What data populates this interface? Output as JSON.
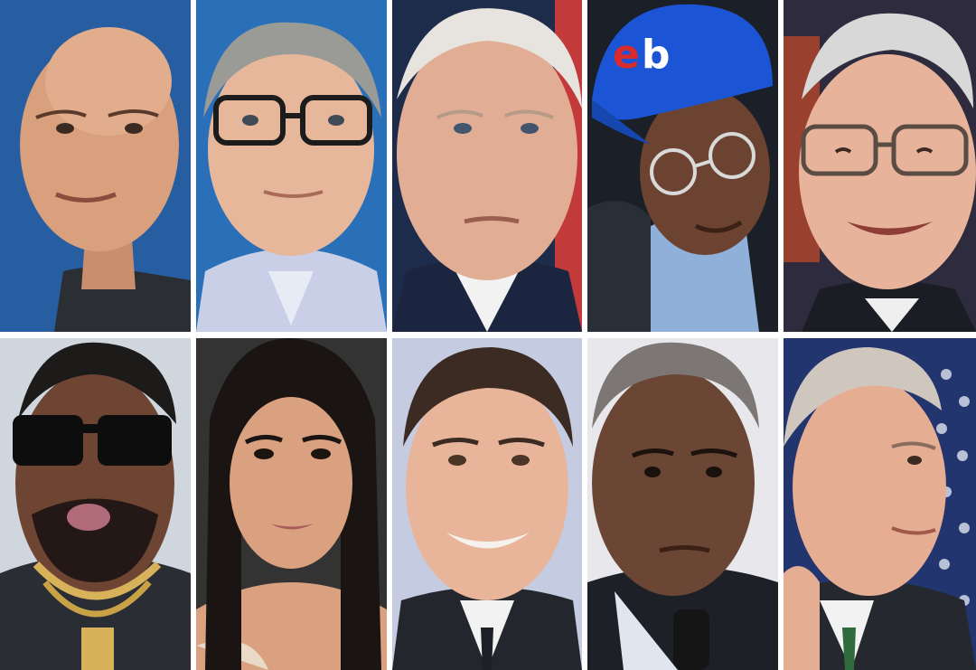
{
  "tiles": [
    {
      "id": "bald-man-blue-bg",
      "background": "#1d4f8f",
      "skin": "#d9a07e",
      "hair": "none",
      "clothing": "#2b2e33"
    },
    {
      "id": "glasses-gray-hair-man",
      "background": "#2a70b8",
      "skin": "#e6b79a",
      "hair": "#9a9a96",
      "clothing": "#c9cfe6"
    },
    {
      "id": "white-hair-man-flag-bg",
      "background": "#1e2c4c",
      "skin": "#e2ad95",
      "hair": "#e7e4df",
      "clothing": "#f2f2f2"
    },
    {
      "id": "man-blue-cap-glasses",
      "background": "#1b1f28",
      "skin": "#6c4331",
      "hair": "none",
      "clothing": "#8fb0d8",
      "cap_color": "#1b55d6"
    },
    {
      "id": "elderly-man-glasses-smiling",
      "background": "#2d2b3d",
      "skin": "#e7b39b",
      "hair": "#d8d8d8",
      "clothing": "#1a1d24"
    },
    {
      "id": "man-dark-sunglasses-chain",
      "background": "#cfd6de",
      "skin": "#6e4533",
      "hair": "#1d1a1a",
      "clothing": "#2a2d33",
      "accent": "#d7b25a"
    },
    {
      "id": "woman-long-dark-hair",
      "background": "#2a2a2a",
      "skin": "#d9a17f",
      "hair": "#1a1413",
      "clothing": "#e9d9c6"
    },
    {
      "id": "smiling-man-suit",
      "background": "#c5cbe0",
      "skin": "#e8b59a",
      "hair": "#3b2b22",
      "clothing": "#23262c"
    },
    {
      "id": "gray-hair-man-microphone",
      "background": "#e8e8ec",
      "skin": "#6b4634",
      "hair": "#7c7774",
      "clothing": "#1d2026"
    },
    {
      "id": "older-man-profile-flag-bg",
      "background": "#22356e",
      "skin": "#e5ad92",
      "hair": "#cfc7be",
      "clothing": "#25282e"
    }
  ]
}
